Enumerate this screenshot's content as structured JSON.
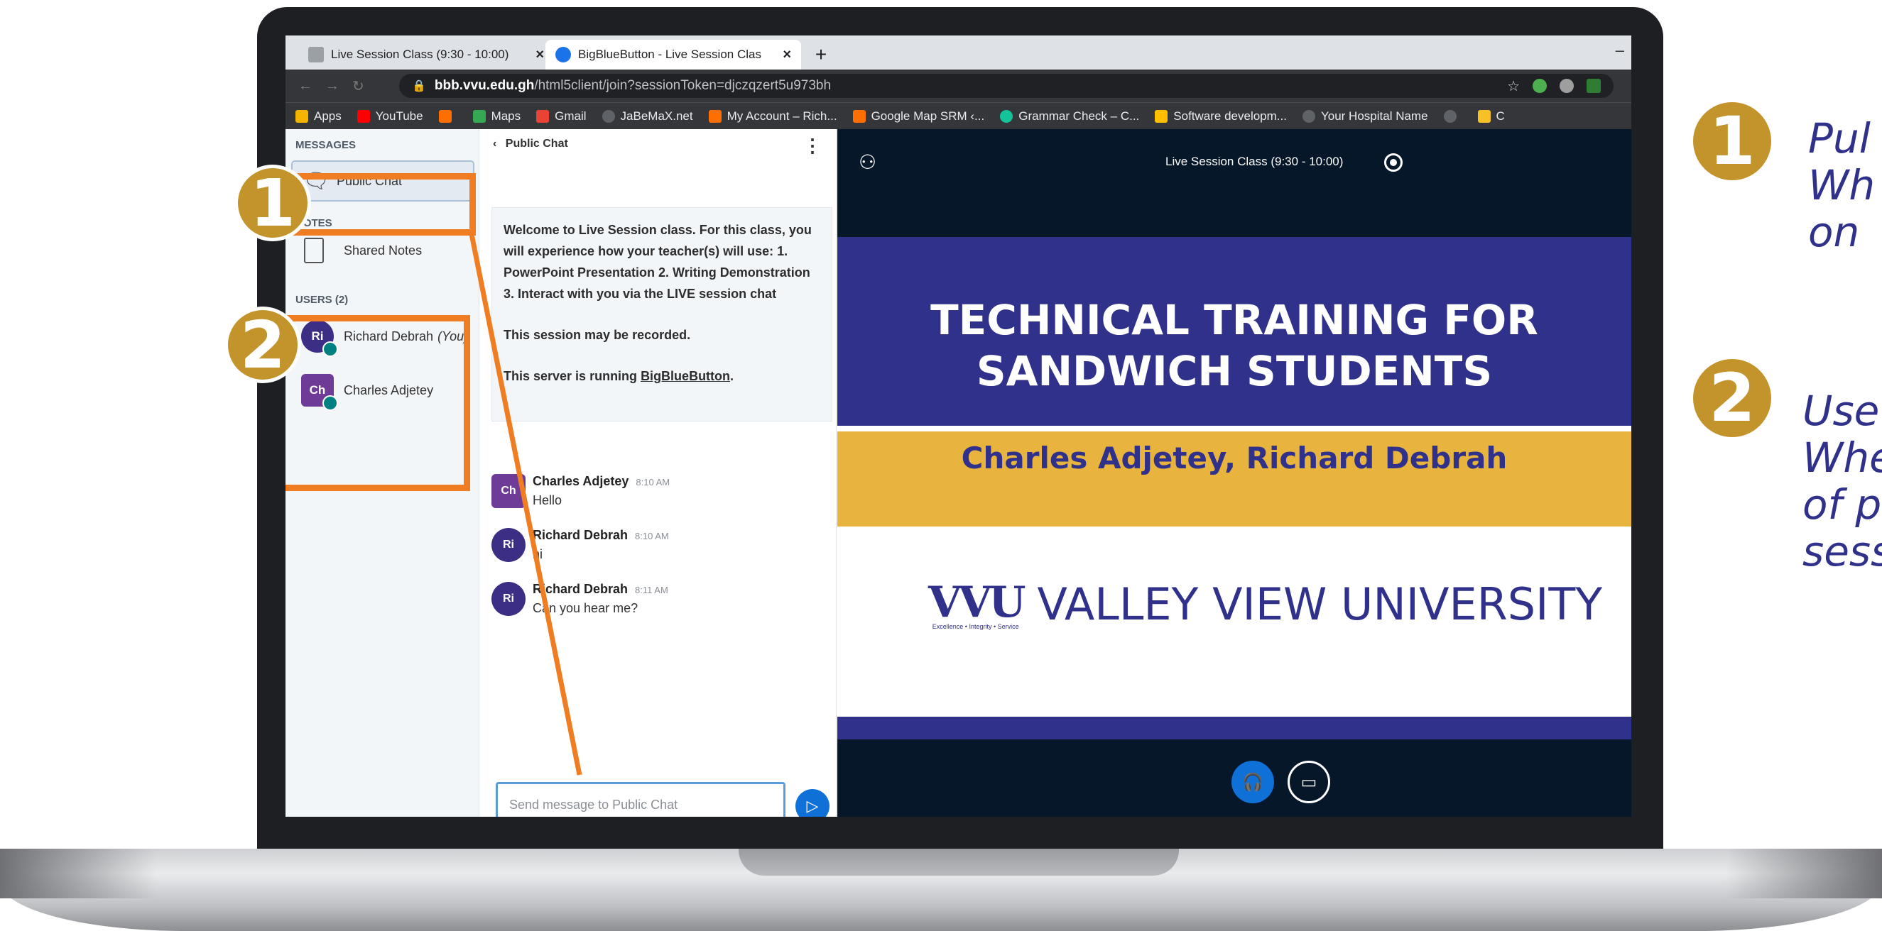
{
  "browser": {
    "tabs": [
      {
        "title": "Live Session Class (9:30 - 10:00)",
        "close": "×"
      },
      {
        "title": "BigBlueButton - Live Session Clas",
        "close": "×"
      }
    ],
    "new_tab": "+",
    "minimize": "–",
    "url_host": "bbb.vvu.edu.gh",
    "url_path": "/html5client/join?sessionToken=djczqzert5u973bh",
    "bookmarks": [
      {
        "label": "Apps",
        "color": "#f4b400"
      },
      {
        "label": "YouTube",
        "color": "#ff0000"
      },
      {
        "label": "",
        "color": "#ff6f00"
      },
      {
        "label": "Maps",
        "color": "#34a853"
      },
      {
        "label": "Gmail",
        "color": "#ea4335"
      },
      {
        "label": "JaBeMaX.net",
        "color": "#5f6368"
      },
      {
        "label": "My Account – Rich...",
        "color": "#ff6f00"
      },
      {
        "label": "Google Map SRM ‹...",
        "color": "#ff6f00"
      },
      {
        "label": "Grammar Check – C...",
        "color": "#15c39a"
      },
      {
        "label": "Software developm...",
        "color": "#ffbf00"
      },
      {
        "label": "Your Hospital Name",
        "color": "#5f6368"
      },
      {
        "label": "",
        "color": "#5f6368"
      },
      {
        "label": "C",
        "color": "#f6c026"
      }
    ]
  },
  "sidebar": {
    "messages_title": "MESSAGES",
    "public_chat": "Public Chat",
    "notes_title": "NOTES",
    "shared_notes": "Shared Notes",
    "users_title": "USERS (2)",
    "users": [
      {
        "initials": "Ri",
        "name": "Richard Debrah",
        "suffix": "(You)",
        "color": "#3b2e84"
      },
      {
        "initials": "Ch",
        "name": "Charles Adjetey",
        "suffix": "",
        "color": "#6e3c97"
      }
    ]
  },
  "chat": {
    "header": "Public Chat",
    "back": "‹",
    "kebab": "⋮",
    "welcome_1": "Welcome to Live Session class. For this class, you will experience how your teacher(s) will use: 1. PowerPoint Presentation 2. Writing Demonstration 3. Interact with you via the LIVE session chat",
    "welcome_2": "This session may be recorded.",
    "welcome_3_pre": "This server is running ",
    "welcome_3_link": "BigBlueButton",
    "welcome_3_post": ".",
    "messages": [
      {
        "initials": "Ch",
        "name": "Charles Adjetey",
        "time": "8:10 AM",
        "text": "Hello",
        "color": "#6e3c97"
      },
      {
        "initials": "Ri",
        "name": "Richard Debrah",
        "time": "8:10 AM",
        "text": "hi",
        "color": "#3b2e84"
      },
      {
        "initials": "Ri",
        "name": "Richard Debrah",
        "time": "8:11 AM",
        "text": "Can you hear me?",
        "color": "#3b2e84"
      }
    ],
    "input_placeholder": "Send message to Public Chat",
    "send": "▷"
  },
  "presentation": {
    "session_title": "Live Session Class (9:30 - 10:00)",
    "slide_title_1": "TECHNICAL TRAINING FOR",
    "slide_title_2": "SANDWICH STUDENTS",
    "slide_subtitle": "Charles Adjetey, Richard Debrah",
    "logo_mark": "VVU",
    "logo_name": "VALLEY VIEW UNIVERSITY",
    "logo_motto": "Excellence • Integrity • Service"
  },
  "annotations": {
    "badge_1": "1",
    "badge_2": "2",
    "callout_1_lines": [
      "Pul",
      "Wh",
      "on"
    ],
    "callout_2_lines": [
      "Use",
      "Whe",
      "of p",
      "sess"
    ]
  },
  "colors": {
    "highlight": "#f07d22",
    "badge": "#c3942b",
    "slide_blue": "#2f318b",
    "slide_gold": "#e8b43d"
  }
}
